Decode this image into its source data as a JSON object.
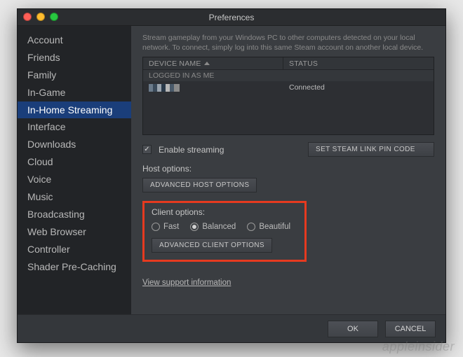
{
  "window": {
    "title": "Preferences"
  },
  "sidebar": {
    "items": [
      {
        "label": "Account"
      },
      {
        "label": "Friends"
      },
      {
        "label": "Family"
      },
      {
        "label": "In-Game"
      },
      {
        "label": "In-Home Streaming",
        "active": true
      },
      {
        "label": "Interface"
      },
      {
        "label": "Downloads"
      },
      {
        "label": "Cloud"
      },
      {
        "label": "Voice"
      },
      {
        "label": "Music"
      },
      {
        "label": "Broadcasting"
      },
      {
        "label": "Web Browser"
      },
      {
        "label": "Controller"
      },
      {
        "label": "Shader Pre-Caching"
      }
    ]
  },
  "main": {
    "description": "Stream gameplay from your Windows PC to other computers detected on your local network. To connect, simply log into this same Steam account on another local device.",
    "table": {
      "col_device": "DEVICE NAME",
      "col_status": "STATUS",
      "section": "LOGGED IN AS ME",
      "row0_status": "Connected"
    },
    "enable_label": "Enable streaming",
    "pin_button": "SET STEAM LINK PIN CODE",
    "host_label": "Host options:",
    "host_button": "ADVANCED HOST OPTIONS",
    "client_label": "Client options:",
    "radio_fast": "Fast",
    "radio_balanced": "Balanced",
    "radio_beautiful": "Beautiful",
    "client_button": "ADVANCED CLIENT OPTIONS",
    "support_link": "View support information"
  },
  "footer": {
    "ok": "OK",
    "cancel": "CANCEL"
  },
  "watermark": "appleinsider"
}
